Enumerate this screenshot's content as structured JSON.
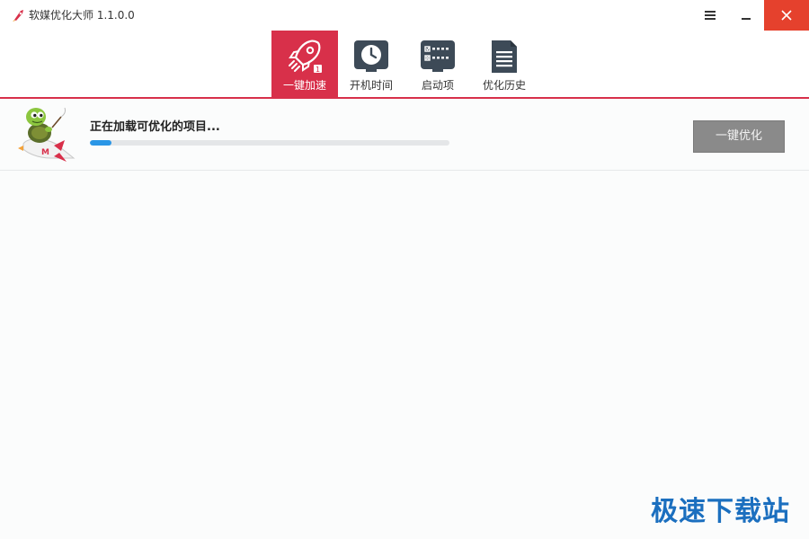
{
  "window": {
    "title": "软媒优化大师 1.1.0.0"
  },
  "toolbar": {
    "tabs": [
      {
        "label": "一键加速",
        "icon": "rocket-icon",
        "active": true
      },
      {
        "label": "开机时间",
        "icon": "clock-icon",
        "active": false
      },
      {
        "label": "启动项",
        "icon": "startup-list-icon",
        "active": false
      },
      {
        "label": "优化历史",
        "icon": "document-icon",
        "active": false
      }
    ],
    "accent_color": "#d8304a"
  },
  "status": {
    "message": "正在加载可优化的项目...",
    "progress": 0.06,
    "progress_color": "#2a96e6",
    "button_label": "一键优化"
  },
  "watermark": {
    "text": "极速下载站"
  }
}
